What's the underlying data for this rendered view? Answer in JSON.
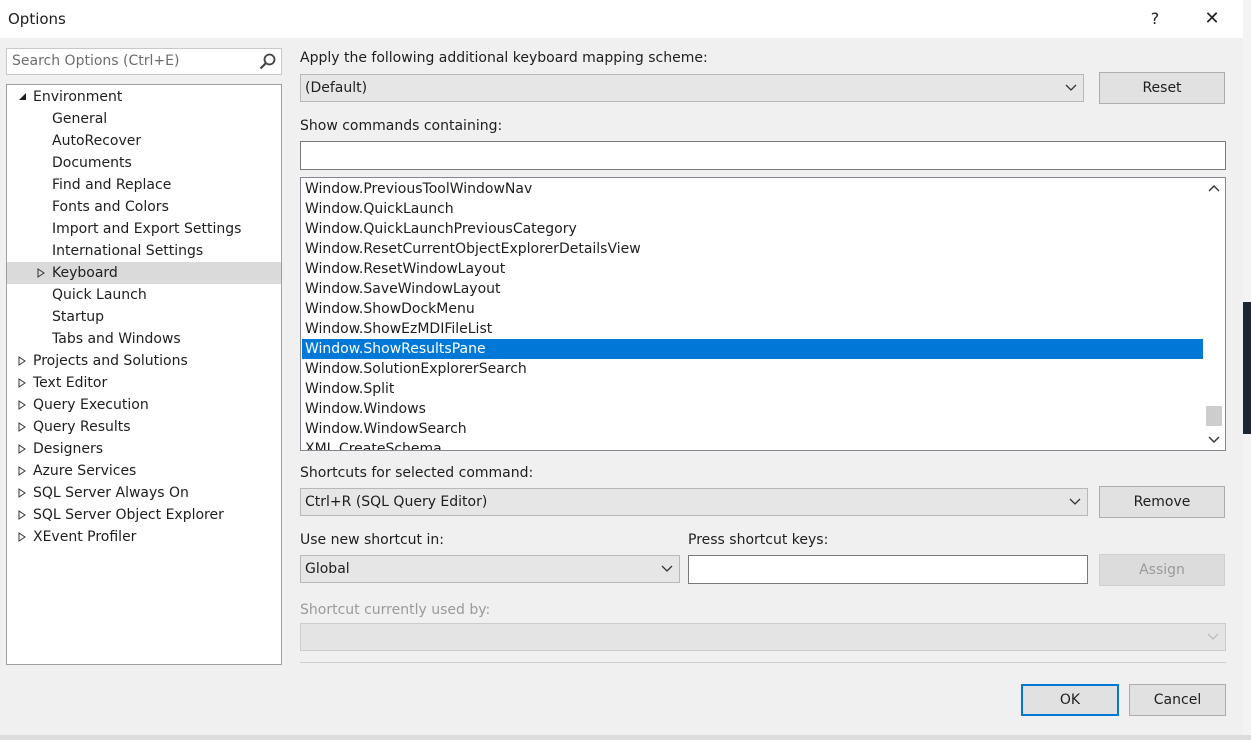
{
  "window": {
    "title": "Options",
    "help": "?",
    "close": "✕"
  },
  "search": {
    "placeholder": "Search Options (Ctrl+E)"
  },
  "tree": [
    {
      "label": "Environment",
      "level": 0,
      "state": "expanded"
    },
    {
      "label": "General",
      "level": 1,
      "state": "leaf"
    },
    {
      "label": "AutoRecover",
      "level": 1,
      "state": "leaf"
    },
    {
      "label": "Documents",
      "level": 1,
      "state": "leaf"
    },
    {
      "label": "Find and Replace",
      "level": 1,
      "state": "leaf"
    },
    {
      "label": "Fonts and Colors",
      "level": 1,
      "state": "leaf"
    },
    {
      "label": "Import and Export Settings",
      "level": 1,
      "state": "leaf"
    },
    {
      "label": "International Settings",
      "level": 1,
      "state": "leaf"
    },
    {
      "label": "Keyboard",
      "level": 1,
      "state": "collapsed",
      "selected": true
    },
    {
      "label": "Quick Launch",
      "level": 1,
      "state": "leaf"
    },
    {
      "label": "Startup",
      "level": 1,
      "state": "leaf"
    },
    {
      "label": "Tabs and Windows",
      "level": 1,
      "state": "leaf"
    },
    {
      "label": "Projects and Solutions",
      "level": 0,
      "state": "collapsed"
    },
    {
      "label": "Text Editor",
      "level": 0,
      "state": "collapsed"
    },
    {
      "label": "Query Execution",
      "level": 0,
      "state": "collapsed"
    },
    {
      "label": "Query Results",
      "level": 0,
      "state": "collapsed"
    },
    {
      "label": "Designers",
      "level": 0,
      "state": "collapsed"
    },
    {
      "label": "Azure Services",
      "level": 0,
      "state": "collapsed"
    },
    {
      "label": "SQL Server Always On",
      "level": 0,
      "state": "collapsed"
    },
    {
      "label": "SQL Server Object Explorer",
      "level": 0,
      "state": "collapsed"
    },
    {
      "label": "XEvent Profiler",
      "level": 0,
      "state": "collapsed"
    }
  ],
  "keyboard": {
    "mapping_label": "Apply the following additional keyboard mapping scheme:",
    "mapping_value": "(Default)",
    "reset_label": "Reset",
    "show_commands_label": "Show commands containing:",
    "show_commands_value": "",
    "commands": [
      {
        "name": "Window.PreviousToolWindowNav"
      },
      {
        "name": "Window.QuickLaunch"
      },
      {
        "name": "Window.QuickLaunchPreviousCategory"
      },
      {
        "name": "Window.ResetCurrentObjectExplorerDetailsView"
      },
      {
        "name": "Window.ResetWindowLayout"
      },
      {
        "name": "Window.SaveWindowLayout"
      },
      {
        "name": "Window.ShowDockMenu"
      },
      {
        "name": "Window.ShowEzMDIFileList"
      },
      {
        "name": "Window.ShowResultsPane",
        "selected": true
      },
      {
        "name": "Window.SolutionExplorerSearch"
      },
      {
        "name": "Window.Split"
      },
      {
        "name": "Window.Windows"
      },
      {
        "name": "Window.WindowSearch"
      },
      {
        "name": "XML.CreateSchema"
      }
    ],
    "shortcuts_label": "Shortcuts for selected command:",
    "shortcuts_value": "Ctrl+R (SQL Query Editor)",
    "remove_label": "Remove",
    "use_in_label": "Use new shortcut in:",
    "use_in_value": "Global",
    "press_keys_label": "Press shortcut keys:",
    "press_keys_value": "",
    "assign_label": "Assign",
    "used_by_label": "Shortcut currently used by:",
    "used_by_value": ""
  },
  "footer": {
    "ok_label": "OK",
    "cancel_label": "Cancel"
  },
  "colors": {
    "selection": "#0078d7",
    "tree_selection": "#dadada",
    "background": "#f0f0f0"
  }
}
